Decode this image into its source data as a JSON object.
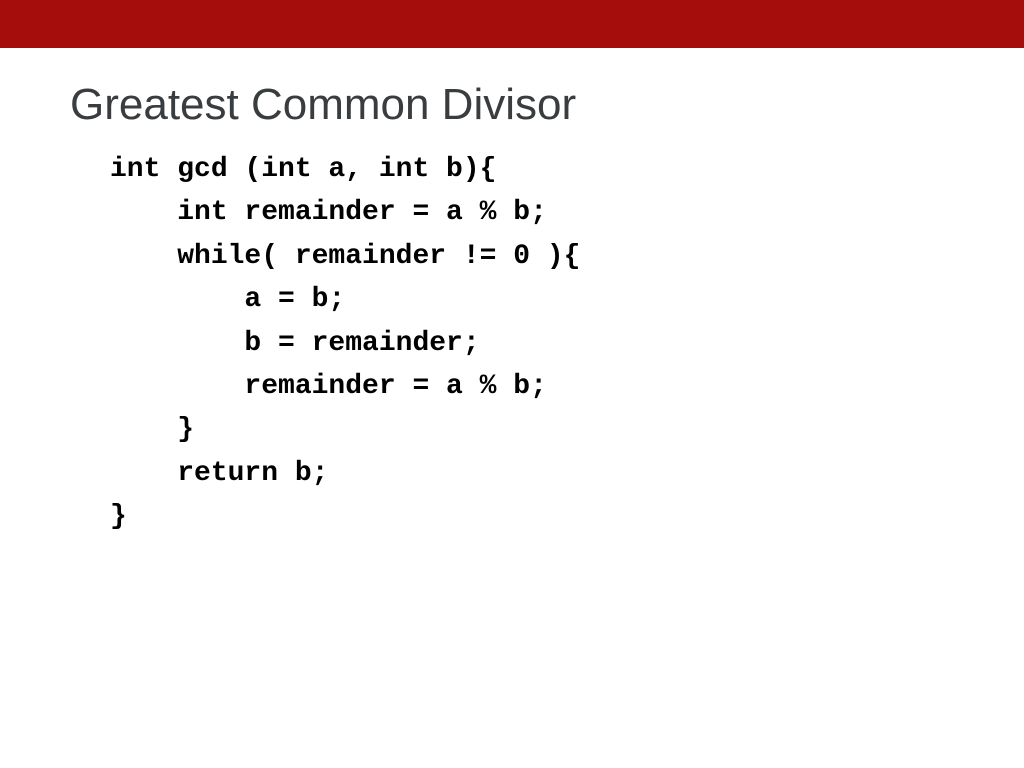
{
  "slide": {
    "title": "Greatest Common Divisor",
    "code": "int gcd (int a, int b){\n    int remainder = a % b;\n    while( remainder != 0 ){\n        a = b;\n        b = remainder;\n        remainder = a % b;\n    }\n    return b;\n}"
  },
  "colors": {
    "header": "#a50d0d",
    "title": "#3a3d40",
    "code": "#000000"
  }
}
